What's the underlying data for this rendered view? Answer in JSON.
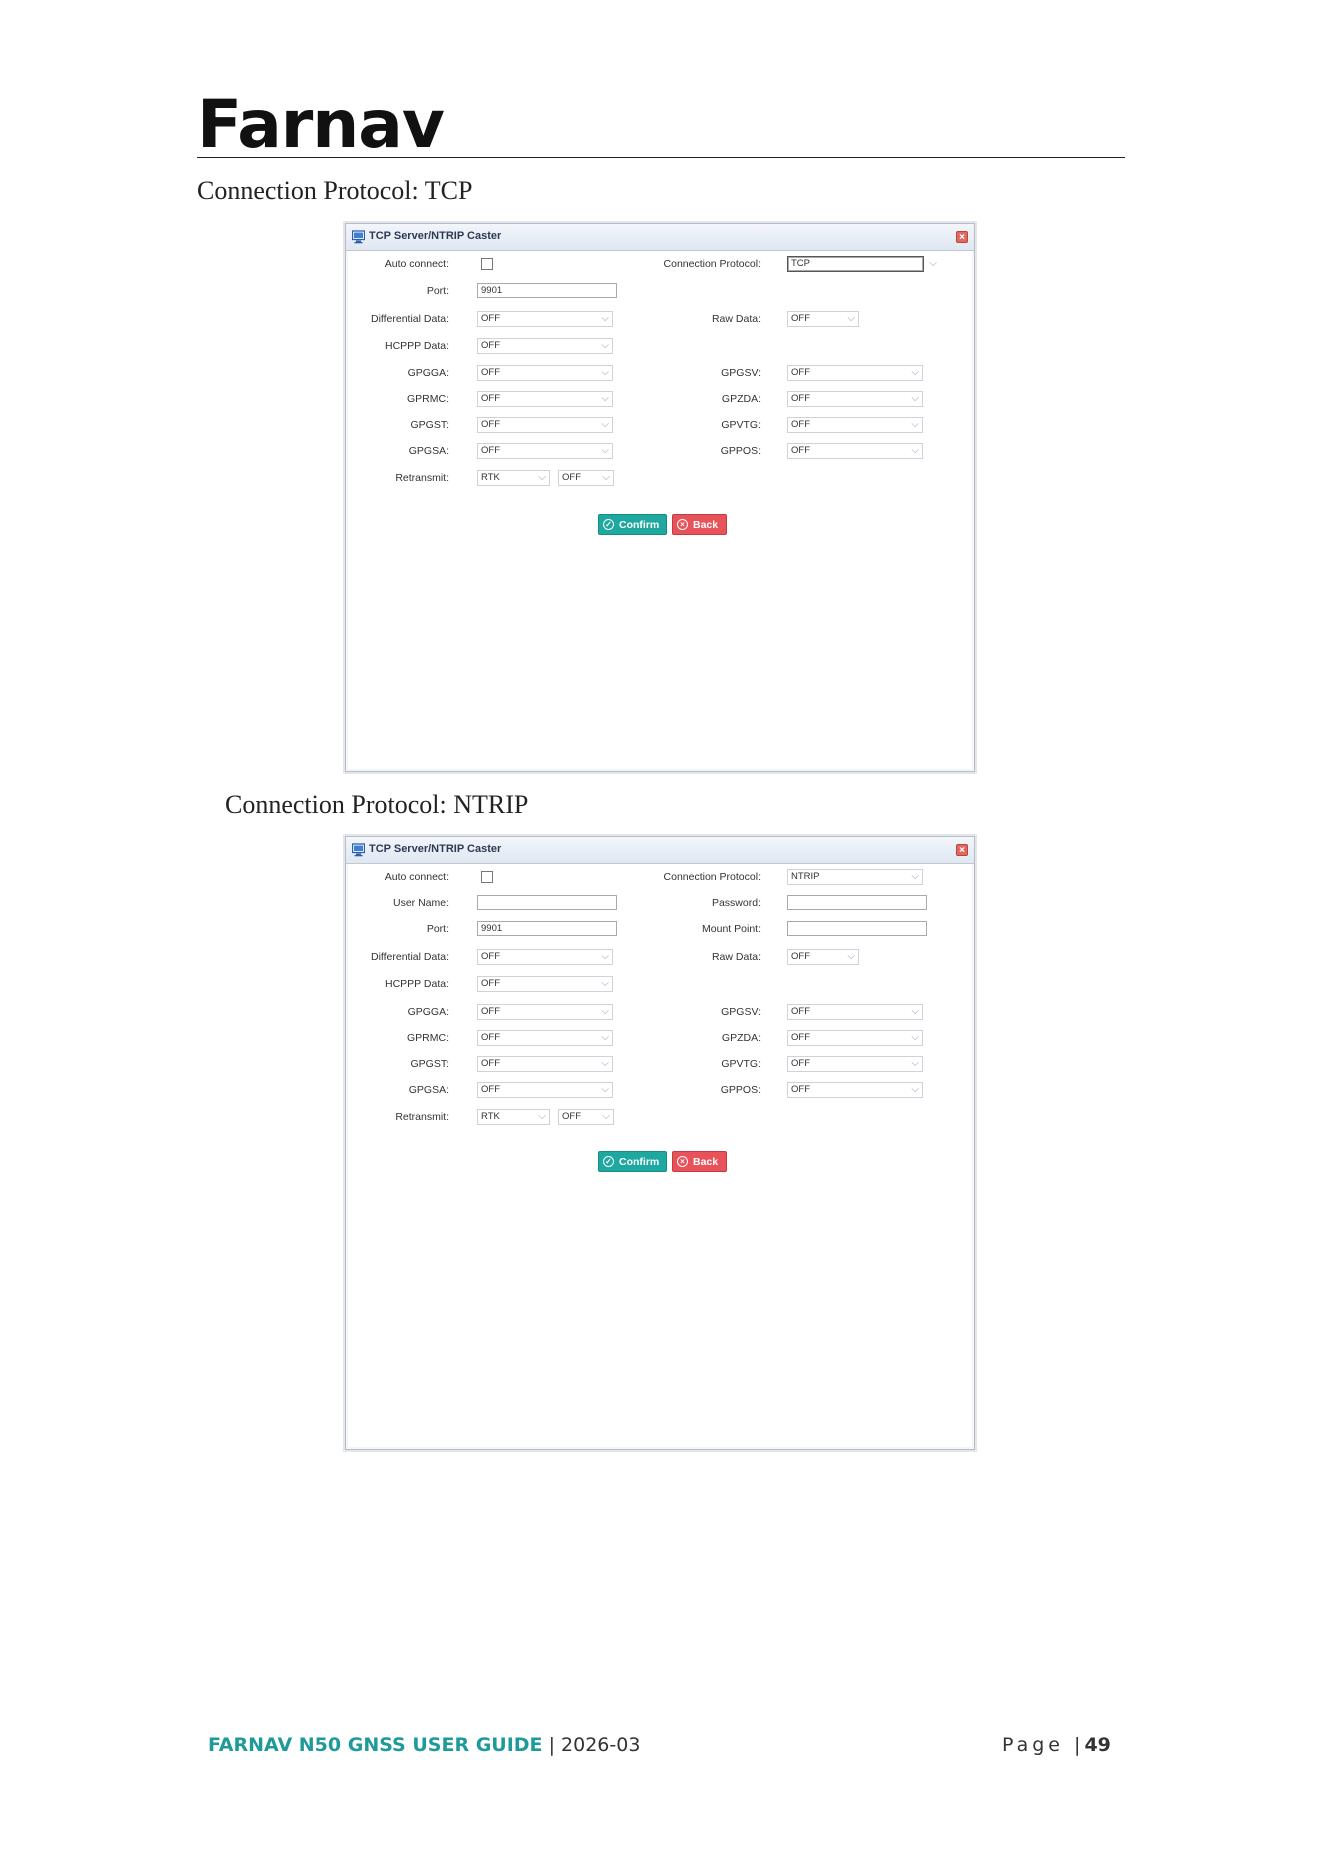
{
  "header": {
    "logo_text": "Farnav"
  },
  "sections": [
    {
      "heading": "Connection Protocol: TCP",
      "dialog": {
        "title": "TCP Server/NTRIP Caster",
        "auto_connect_label": "Auto connect:",
        "connection_protocol_label": "Connection Protocol:",
        "connection_protocol_value": "TCP",
        "port_label": "Port:",
        "port_value": "9901",
        "differential_label": "Differential Data:",
        "differential_value": "OFF",
        "raw_label": "Raw Data:",
        "raw_value": "OFF",
        "hcppp_label": "HCPPP Data:",
        "hcppp_value": "OFF",
        "gpgga_label": "GPGGA:",
        "gpgga_value": "OFF",
        "gpgsv_label": "GPGSV:",
        "gpgsv_value": "OFF",
        "gprmc_label": "GPRMC:",
        "gprmc_value": "OFF",
        "gpzda_label": "GPZDA:",
        "gpzda_value": "OFF",
        "gpgst_label": "GPGST:",
        "gpgst_value": "OFF",
        "gpvtg_label": "GPVTG:",
        "gpvtg_value": "OFF",
        "gpgsa_label": "GPGSA:",
        "gpgsa_value": "OFF",
        "gppos_label": "GPPOS:",
        "gppos_value": "OFF",
        "retransmit_label": "Retransmit:",
        "retransmit_mode": "RTK",
        "retransmit_value": "OFF",
        "confirm_label": "Confirm",
        "back_label": "Back"
      }
    },
    {
      "heading": "Connection Protocol: NTRIP",
      "dialog": {
        "title": "TCP Server/NTRIP Caster",
        "auto_connect_label": "Auto connect:",
        "connection_protocol_label": "Connection Protocol:",
        "connection_protocol_value": "NTRIP",
        "user_name_label": "User Name:",
        "user_name_value": "",
        "password_label": "Password:",
        "password_value": "",
        "port_label": "Port:",
        "port_value": "9901",
        "mount_point_label": "Mount Point:",
        "mount_point_value": "",
        "differential_label": "Differential Data:",
        "differential_value": "OFF",
        "raw_label": "Raw Data:",
        "raw_value": "OFF",
        "hcppp_label": "HCPPP Data:",
        "hcppp_value": "OFF",
        "gpgga_label": "GPGGA:",
        "gpgga_value": "OFF",
        "gpgsv_label": "GPGSV:",
        "gpgsv_value": "OFF",
        "gprmc_label": "GPRMC:",
        "gprmc_value": "OFF",
        "gpzda_label": "GPZDA:",
        "gpzda_value": "OFF",
        "gpgst_label": "GPGST:",
        "gpgst_value": "OFF",
        "gpvtg_label": "GPVTG:",
        "gpvtg_value": "OFF",
        "gpgsa_label": "GPGSA:",
        "gpgsa_value": "OFF",
        "gppos_label": "GPPOS:",
        "gppos_value": "OFF",
        "retransmit_label": "Retransmit:",
        "retransmit_mode": "RTK",
        "retransmit_value": "OFF",
        "confirm_label": "Confirm",
        "back_label": "Back"
      }
    }
  ],
  "footer": {
    "brand": "FARNAV N50 GNSS USER GUIDE",
    "separator": " | ",
    "date": "2026-03",
    "page_label": "Page",
    "page_separator": " |",
    "page_number": "49"
  },
  "colors": {
    "confirm": "#1ea8a0",
    "back": "#e8535a",
    "footer_brand": "#1f9a9a"
  }
}
